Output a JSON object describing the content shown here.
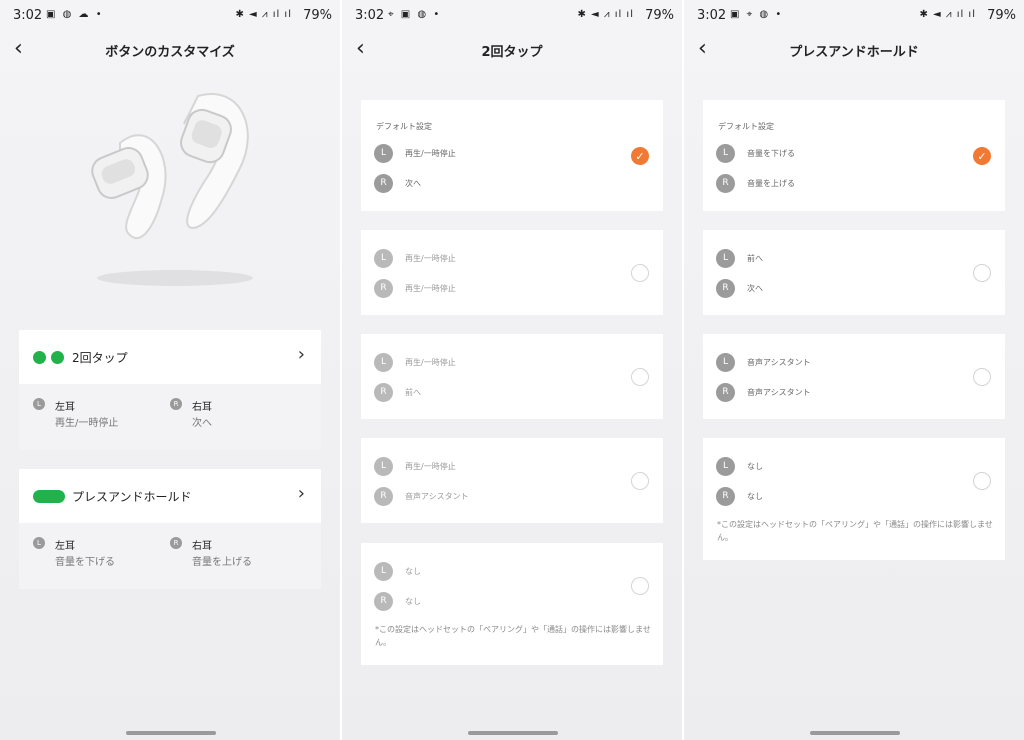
{
  "status": {
    "time": "3:02",
    "battery": "79%"
  },
  "panels": [
    {
      "title": "ボタンのカスタマイズ",
      "cards": [
        {
          "label": "2回タップ",
          "left": {
            "badge": "L",
            "name": "左耳",
            "value": "再生/一時停止"
          },
          "right": {
            "badge": "R",
            "name": "右耳",
            "value": "次へ"
          }
        },
        {
          "label": "プレスアンドホールド",
          "left": {
            "badge": "L",
            "name": "左耳",
            "value": "音量を下げる"
          },
          "right": {
            "badge": "R",
            "name": "右耳",
            "value": "音量を上げる"
          }
        }
      ]
    },
    {
      "title": "2回タップ",
      "default_label": "デフォルト設定",
      "options": [
        {
          "l": "再生/一時停止",
          "r": "次へ",
          "selected": true
        },
        {
          "l": "再生/一時停止",
          "r": "再生/一時停止",
          "selected": false
        },
        {
          "l": "再生/一時停止",
          "r": "前へ",
          "selected": false
        },
        {
          "l": "再生/一時停止",
          "r": "音声アシスタント",
          "selected": false
        },
        {
          "l": "なし",
          "r": "なし",
          "selected": false
        }
      ],
      "note": "*この設定はヘッドセットの「ペアリング」や「通話」の操作には影響しません。"
    },
    {
      "title": "プレスアンドホールド",
      "default_label": "デフォルト設定",
      "options": [
        {
          "l": "音量を下げる",
          "r": "音量を上げる",
          "selected": true
        },
        {
          "l": "前へ",
          "r": "次へ",
          "selected": false
        },
        {
          "l": "音声アシスタント",
          "r": "音声アシスタント",
          "selected": false
        },
        {
          "l": "なし",
          "r": "なし",
          "selected": false
        }
      ],
      "note": "*この設定はヘッドセットの「ペアリング」や「通話」の操作には影響しません。"
    }
  ],
  "badges": {
    "left": "L",
    "right": "R"
  },
  "icons": {
    "back": "chevron-left-icon",
    "forward": "chevron-right-icon",
    "check": "check-icon"
  },
  "colors": {
    "accent": "#f07a33",
    "green": "#22b24c"
  }
}
